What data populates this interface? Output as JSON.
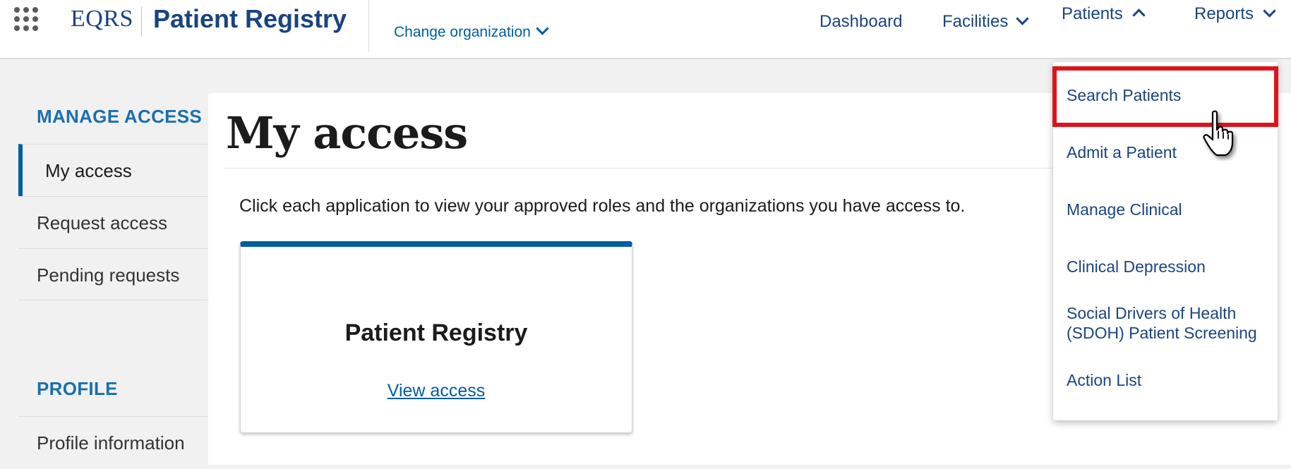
{
  "header": {
    "brand_short": "EQRS",
    "brand_app": "Patient Registry",
    "change_org": "Change organization",
    "nav": {
      "dashboard": "Dashboard",
      "facilities": "Facilities",
      "patients": "Patients",
      "reports": "Reports"
    }
  },
  "sidebar": {
    "manage_heading": "MANAGE ACCESS",
    "items": [
      {
        "label": "My access"
      },
      {
        "label": "Request access"
      },
      {
        "label": "Pending requests"
      }
    ],
    "profile_heading": "PROFILE",
    "profile_items": [
      {
        "label": "Profile information"
      }
    ]
  },
  "main": {
    "title": "My access",
    "intro": "Click each application to view your approved roles and the organizations you have access to.",
    "card": {
      "title": "Patient Registry",
      "link": "View access"
    }
  },
  "patients_menu": {
    "items": [
      {
        "label": "Search Patients"
      },
      {
        "label": "Admit a Patient"
      },
      {
        "label": "Manage Clinical"
      },
      {
        "label": "Clinical Depression"
      },
      {
        "label": "Social Drivers of Health",
        "label2": "(SDOH) Patient Screening"
      },
      {
        "label": "Action List"
      }
    ]
  },
  "colors": {
    "brand_blue": "#1a4480",
    "link_blue": "#005ea2",
    "highlight_red": "#e0131a"
  }
}
